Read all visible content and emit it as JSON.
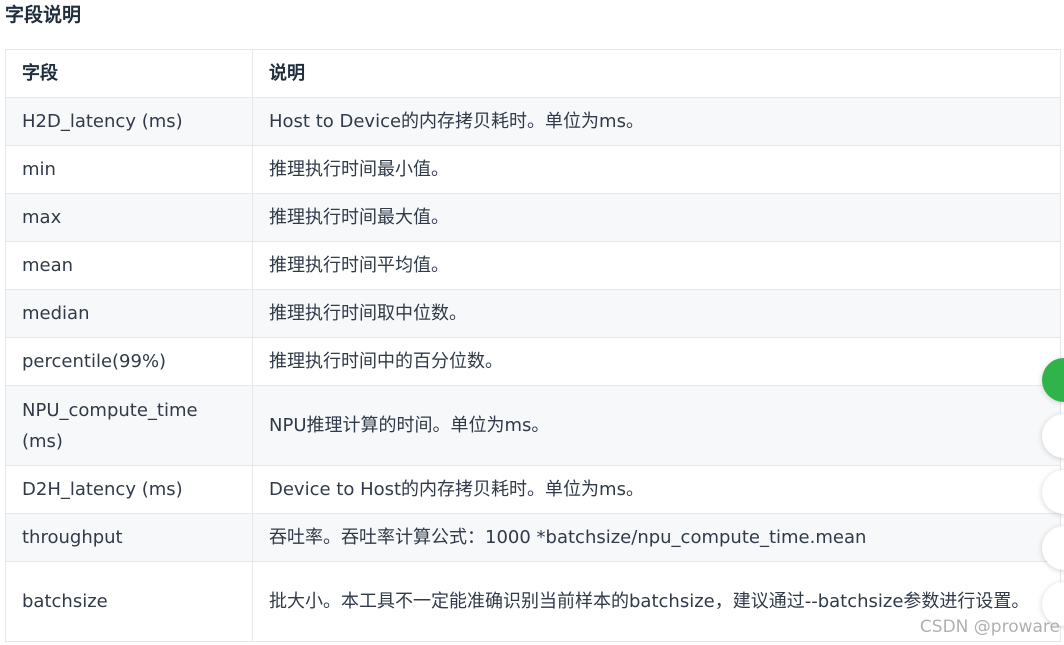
{
  "section_title": "字段说明",
  "table": {
    "headers": [
      "字段",
      "说明"
    ],
    "rows": [
      {
        "field": "H2D_latency (ms)",
        "desc": "Host to Device的内存拷贝耗时。单位为ms。"
      },
      {
        "field": "min",
        "desc": "推理执行时间最小值。"
      },
      {
        "field": "max",
        "desc": "推理执行时间最大值。"
      },
      {
        "field": "mean",
        "desc": "推理执行时间平均值。"
      },
      {
        "field": "median",
        "desc": "推理执行时间取中位数。"
      },
      {
        "field": "percentile(99%)",
        "desc": "推理执行时间中的百分位数。"
      },
      {
        "field": "NPU_compute_time (ms)",
        "desc": "NPU推理计算的时间。单位为ms。"
      },
      {
        "field": "D2H_latency (ms)",
        "desc": "Device to Host的内存拷贝耗时。单位为ms。"
      },
      {
        "field": "throughput",
        "desc": "吞吐率。吞吐率计算公式：1000 *batchsize/npu_compute_time.mean"
      },
      {
        "field": "batchsize",
        "desc": "批大小。本工具不一定能准确识别当前样本的batchsize，建议通过--batchsize参数进行设置。"
      }
    ]
  },
  "watermark": "CSDN @proware",
  "colors": {
    "header_text": "#1f2d3d",
    "cell_text": "#303a48",
    "border": "#e5e7eb",
    "row_alt_bg": "#f7f8fa",
    "side_button_active": "#2fb34a"
  }
}
